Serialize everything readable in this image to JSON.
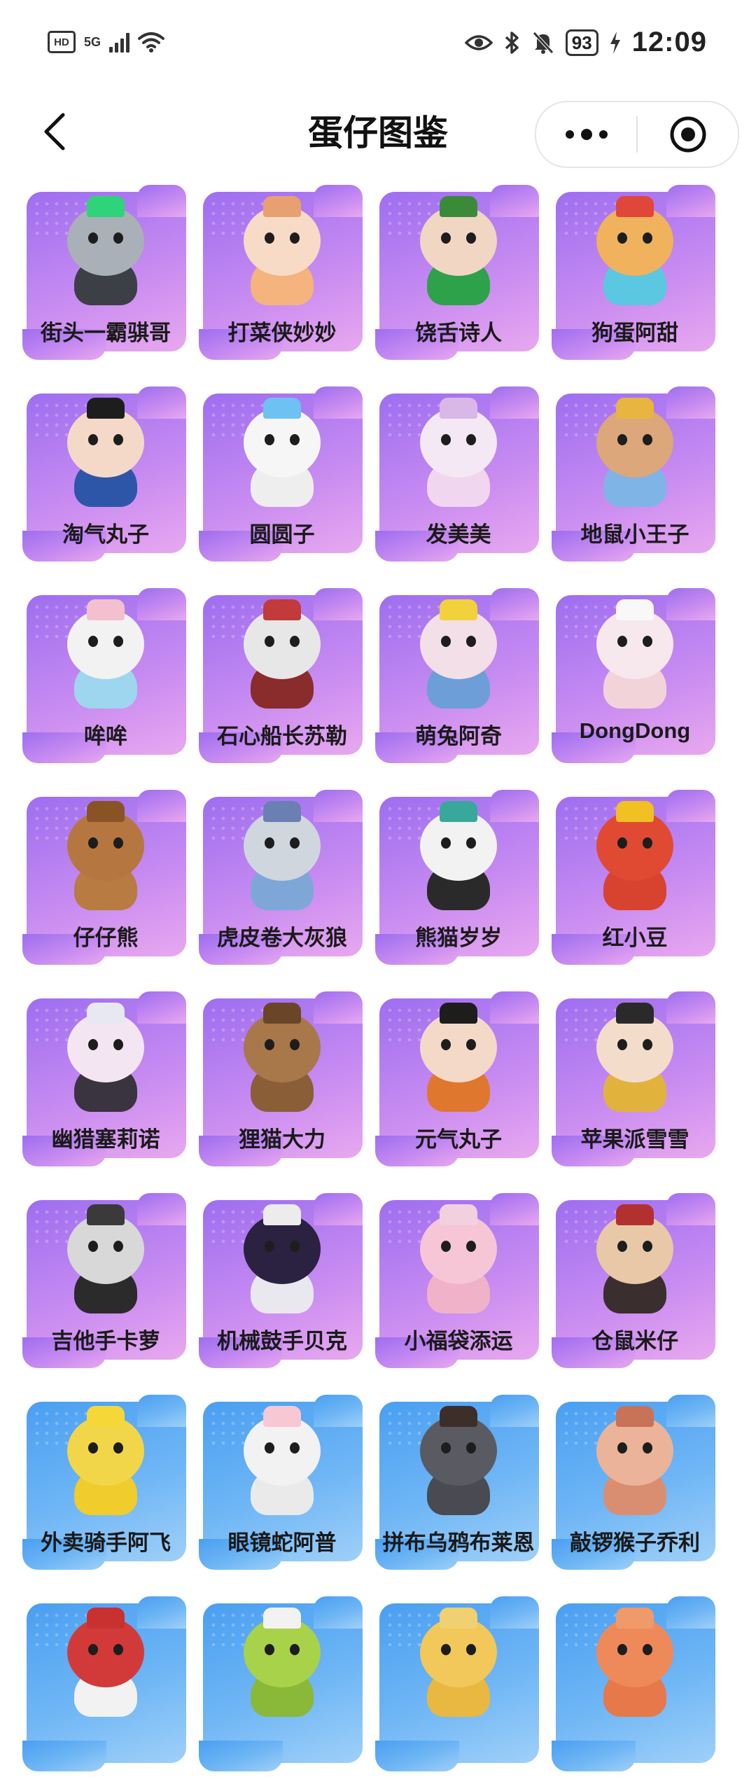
{
  "status_bar": {
    "hd": "HD",
    "network": "5G",
    "battery": "93",
    "time": "12:09",
    "icons": [
      "eye-icon",
      "bluetooth-icon",
      "bell-off-icon",
      "charging-icon"
    ]
  },
  "navbar": {
    "title": "蛋仔图鉴",
    "back_icon": "chevron-left-icon",
    "more_icon": "more-dots-icon",
    "close_icon": "target-circle-icon"
  },
  "cards": [
    {
      "label": "街头一霸骐哥",
      "theme": "purple",
      "head": "#a9b0b8",
      "body": "#3c3f45",
      "acc": "#2fd37a"
    },
    {
      "label": "打菜侠妙妙",
      "theme": "purple",
      "head": "#f7dbc6",
      "body": "#f5b37d",
      "acc": "#e9a070"
    },
    {
      "label": "饶舌诗人",
      "theme": "purple",
      "head": "#f2d6c4",
      "body": "#2ea24a",
      "acc": "#3a8a3a"
    },
    {
      "label": "狗蛋阿甜",
      "theme": "purple",
      "head": "#f0b25c",
      "body": "#5cc7e0",
      "acc": "#e0463a"
    },
    {
      "label": "淘气丸子",
      "theme": "purple",
      "head": "#f4d9c8",
      "body": "#2d56a8",
      "acc": "#1d1d1d"
    },
    {
      "label": "圆圆子",
      "theme": "purple",
      "head": "#f6f6f6",
      "body": "#eeeeee",
      "acc": "#6ec1f3"
    },
    {
      "label": "发美美",
      "theme": "purple",
      "head": "#f3e8f4",
      "body": "#f0d6ef",
      "acc": "#d9b8e8"
    },
    {
      "label": "地鼠小王子",
      "theme": "purple",
      "head": "#dca77a",
      "body": "#7fb4e6",
      "acc": "#e7b540"
    },
    {
      "label": "哞哞",
      "theme": "purple",
      "head": "#f2f2f2",
      "body": "#9fd6ef",
      "acc": "#f3c0d0"
    },
    {
      "label": "石心船长苏勒",
      "theme": "purple",
      "head": "#e7e7e7",
      "body": "#8a2c2c",
      "acc": "#c23a3a"
    },
    {
      "label": "萌兔阿奇",
      "theme": "purple",
      "head": "#f3dfe8",
      "body": "#6e9ed8",
      "acc": "#f1d23c"
    },
    {
      "label": "DongDong",
      "theme": "purple",
      "head": "#f6e8ec",
      "body": "#f2d3da",
      "acc": "#f8f8f8"
    },
    {
      "label": "仔仔熊",
      "theme": "purple",
      "head": "#b5773f",
      "body": "#b87b42",
      "acc": "#8a5326"
    },
    {
      "label": "虎皮卷大灰狼",
      "theme": "purple",
      "head": "#cfd6de",
      "body": "#7ea7d8",
      "acc": "#6a7fb2"
    },
    {
      "label": "熊猫岁岁",
      "theme": "purple",
      "head": "#f2f2f2",
      "body": "#2a2a2a",
      "acc": "#39a89a"
    },
    {
      "label": "红小豆",
      "theme": "purple",
      "head": "#e04a33",
      "body": "#d84330",
      "acc": "#f0c024"
    },
    {
      "label": "幽猎塞莉诺",
      "theme": "purple",
      "head": "#f3e6f2",
      "body": "#3a3340",
      "acc": "#e8e8f2"
    },
    {
      "label": "狸猫大力",
      "theme": "purple",
      "head": "#a8784a",
      "body": "#8a5e36",
      "acc": "#6a4528"
    },
    {
      "label": "元气丸子",
      "theme": "purple",
      "head": "#f4d9c8",
      "body": "#e0772f",
      "acc": "#1d1d1d"
    },
    {
      "label": "苹果派雪雪",
      "theme": "purple",
      "head": "#f4dccb",
      "body": "#e1b33c",
      "acc": "#2a2a2a"
    },
    {
      "label": "吉他手卡萝",
      "theme": "purple",
      "head": "#d8d8d8",
      "body": "#2b2b2b",
      "acc": "#3a3a3a"
    },
    {
      "label": "机械鼓手贝克",
      "theme": "purple",
      "head": "#2a2240",
      "body": "#e8e8ee",
      "acc": "#ececec"
    },
    {
      "label": "小福袋添运",
      "theme": "purple",
      "head": "#f6c6d6",
      "body": "#f0b2c8",
      "acc": "#f3d0de"
    },
    {
      "label": "仓鼠米仔",
      "theme": "purple",
      "head": "#e9c8a8",
      "body": "#3a2e2e",
      "acc": "#b33030"
    },
    {
      "label": "外卖骑手阿飞",
      "theme": "blue",
      "head": "#f2d64a",
      "body": "#f0cc2c",
      "acc": "#f5d838"
    },
    {
      "label": "眼镜蛇阿普",
      "theme": "blue",
      "head": "#f2f2f2",
      "body": "#eaeaea",
      "acc": "#f7c8d4"
    },
    {
      "label": "拼布乌鸦布莱恩",
      "theme": "blue",
      "head": "#5a5a62",
      "body": "#4a4a52",
      "acc": "#3e2e2a"
    },
    {
      "label": "敲锣猴子乔利",
      "theme": "blue",
      "head": "#eab39a",
      "body": "#d98e72",
      "acc": "#c87258"
    },
    {
      "label": "",
      "theme": "blue",
      "head": "#d23a3a",
      "body": "#f2f2f2",
      "acc": "#c93030"
    },
    {
      "label": "",
      "theme": "blue",
      "head": "#a8d24a",
      "body": "#8ab838",
      "acc": "#f2f2f2"
    },
    {
      "label": "",
      "theme": "blue",
      "head": "#f2c85a",
      "body": "#e8b840",
      "acc": "#f0d070"
    },
    {
      "label": "",
      "theme": "blue",
      "head": "#ee8a5a",
      "body": "#e6784a",
      "acc": "#f09a6a"
    }
  ]
}
